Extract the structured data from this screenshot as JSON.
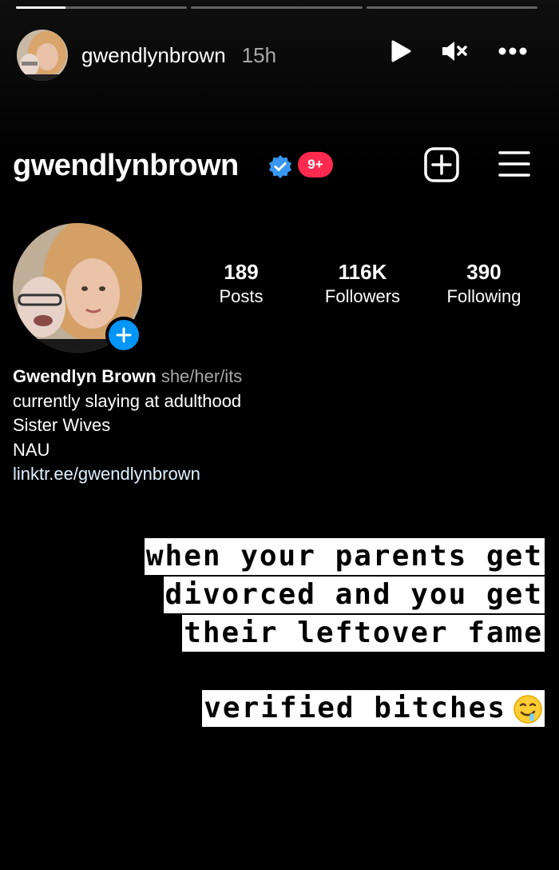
{
  "story": {
    "progress": [
      0.29,
      0,
      0
    ],
    "username": "gwendlynbrown",
    "time": "15h",
    "icons": [
      "play-icon",
      "mute-icon",
      "more-icon"
    ]
  },
  "profile": {
    "handle": "gwendlynbrown",
    "badge": "9+",
    "stats": [
      {
        "value": "189",
        "label": "Posts"
      },
      {
        "value": "116K",
        "label": "Followers"
      },
      {
        "value": "390",
        "label": "Following"
      }
    ],
    "bio": {
      "name": "Gwendlyn Brown",
      "pronouns": "she/her/its",
      "line1": "currently slaying at adulthood",
      "line2": "Sister Wives",
      "line3": "NAU",
      "link": "linktr.ee/gwendlynbrown"
    }
  },
  "caption": {
    "lines": [
      "when your parents get",
      "divorced and you get",
      "their leftover fame"
    ],
    "tagline": "verified bitches"
  },
  "colors": {
    "accent_blue": "#0095f6",
    "badge_red": "#ff2a4f",
    "verified_blue": "#3897f0"
  }
}
